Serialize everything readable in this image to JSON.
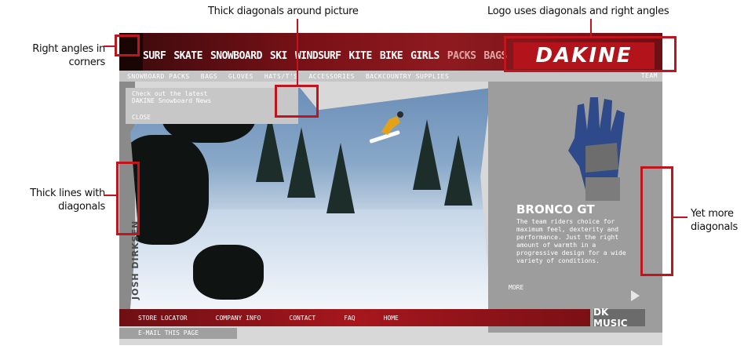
{
  "annotations": {
    "top_center": "Thick diagonals around picture",
    "top_right": "Logo uses diagonals and right angles",
    "left_top": [
      "Right angles in",
      "corners"
    ],
    "left_mid": [
      "Thick lines with",
      "diagonals"
    ],
    "right_mid": [
      "Yet more",
      "diagonals"
    ]
  },
  "site": {
    "main_nav": [
      "SURF",
      "SKATE",
      "SNOWBOARD",
      "SKI",
      "WINDSURF",
      "KITE",
      "BIKE",
      "GIRLS",
      "PACKS",
      "BAGS"
    ],
    "logo_text": "DAKINE",
    "sub_nav": [
      "SNOWBOARD PACKS",
      "BAGS",
      "GLOVES",
      "HATS/T'S",
      "ACCESSORIES",
      "BACKCOUNTRY SUPPLIES"
    ],
    "team_link": "TEAM",
    "news": [
      "Check out the latest",
      "DAKINE Snowboard News"
    ],
    "close": "CLOSE",
    "rider_name": "JOSH DIRKSEN",
    "product": {
      "name": "BRONCO GT",
      "description": "The team riders choice for maximum feel, dexterity and performance. Just the right amount of warmth in a progressive design for a wide variety of conditions.",
      "more": "MORE"
    },
    "dk_music": "DK MUSIC",
    "footer_links": [
      "STORE LOCATOR",
      "COMPANY INFO",
      "CONTACT",
      "FAQ",
      "HOME"
    ],
    "email_page": "E-MAIL THIS PAGE"
  },
  "colors": {
    "brand_red": "#b3141b",
    "annotation_red": "#c0151c"
  }
}
